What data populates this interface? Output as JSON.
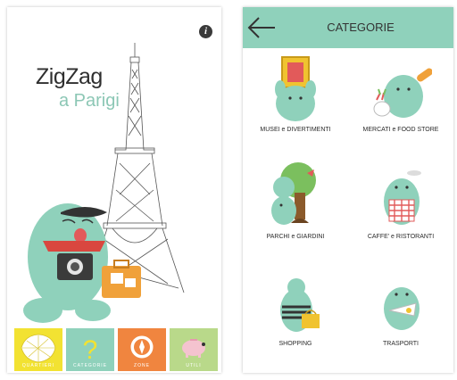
{
  "left_screen": {
    "title_line1": "ZigZag",
    "title_line2": "a Parigi",
    "info_glyph": "i",
    "tiles": [
      {
        "label": "QUARTIERI",
        "color": "#f2e232"
      },
      {
        "label": "CATEGORIE",
        "color": "#8fd1bb"
      },
      {
        "label": "ZONE",
        "color": "#f0853f"
      },
      {
        "label": "UTILI",
        "color": "#b9d98a"
      }
    ]
  },
  "right_screen": {
    "header_title": "CATEGORIE",
    "categories": [
      {
        "label": "MUSEI e DIVERTIMENTI",
        "icon": "museum-mascot-icon"
      },
      {
        "label": "MERCATI e FOOD STORE",
        "icon": "market-mascot-icon"
      },
      {
        "label": "PARCHI e GIARDINI",
        "icon": "park-mascot-icon"
      },
      {
        "label": "CAFFE' e RISTORANTI",
        "icon": "cafe-mascot-icon"
      },
      {
        "label": "SHOPPING",
        "icon": "shopping-mascot-icon"
      },
      {
        "label": "TRASPORTI",
        "icon": "transport-mascot-icon"
      }
    ]
  },
  "colors": {
    "mascot": "#8fd1bb",
    "header": "#8fd1bb",
    "title_accent": "#8cc7b5"
  }
}
